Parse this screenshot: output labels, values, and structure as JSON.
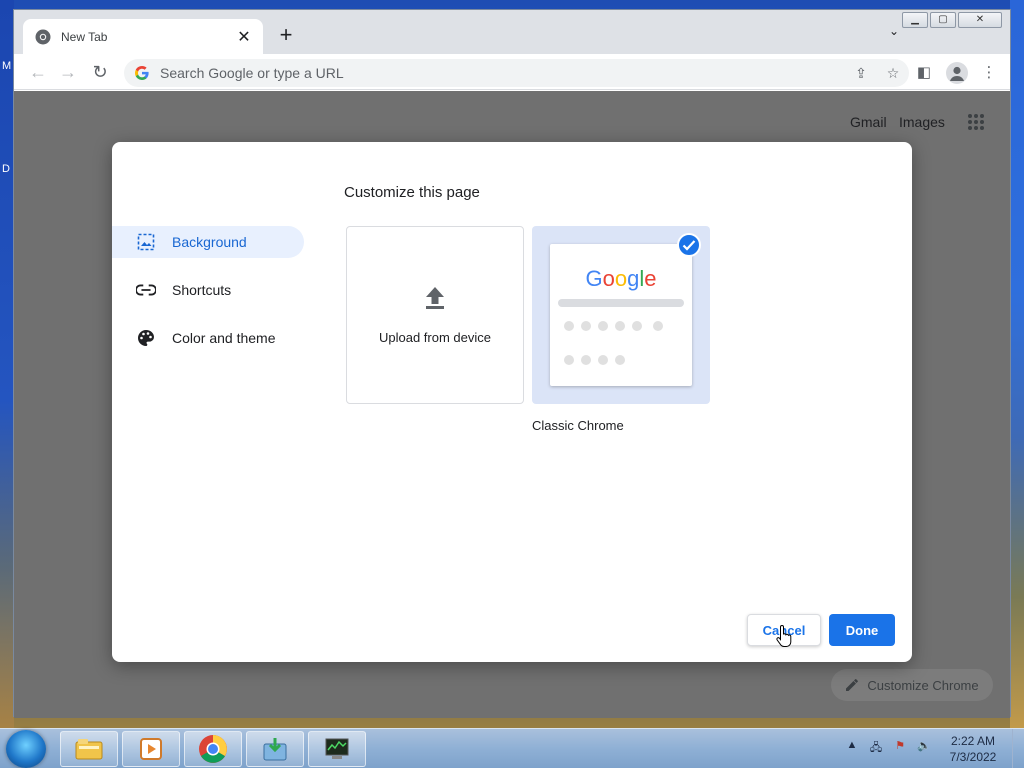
{
  "desktop": {
    "edge_letters": [
      "M",
      "D"
    ]
  },
  "browser": {
    "tab": {
      "title": "New Tab",
      "close_glyph": "✕"
    },
    "new_tab_glyph": "+",
    "tab_search_glyph": "⌄",
    "window_controls": {
      "minimize": "▁",
      "maximize": "▢",
      "close": "✕"
    },
    "omnibox": {
      "placeholder": "Search Google or type a URL",
      "value": ""
    }
  },
  "ntp": {
    "gmail_link": "Gmail",
    "images_link": "Images",
    "customize_chrome_label": "Customize Chrome"
  },
  "dialog": {
    "title": "Customize this page",
    "menu": [
      {
        "label": "Background",
        "icon": "image-icon",
        "active": true
      },
      {
        "label": "Shortcuts",
        "icon": "link-icon",
        "active": false
      },
      {
        "label": "Color and theme",
        "icon": "palette-icon",
        "active": false
      }
    ],
    "upload_tile_label": "Upload from device",
    "classic_tile_label": "Classic Chrome",
    "classic_preview_logo": "Google",
    "cancel_label": "Cancel",
    "done_label": "Done"
  },
  "taskbar": {
    "time": "2:22 AM",
    "date": "7/3/2022"
  },
  "colors": {
    "accent": "#1a73e8",
    "active_menu_bg": "#e8f0fe",
    "overlay": "#707070"
  }
}
